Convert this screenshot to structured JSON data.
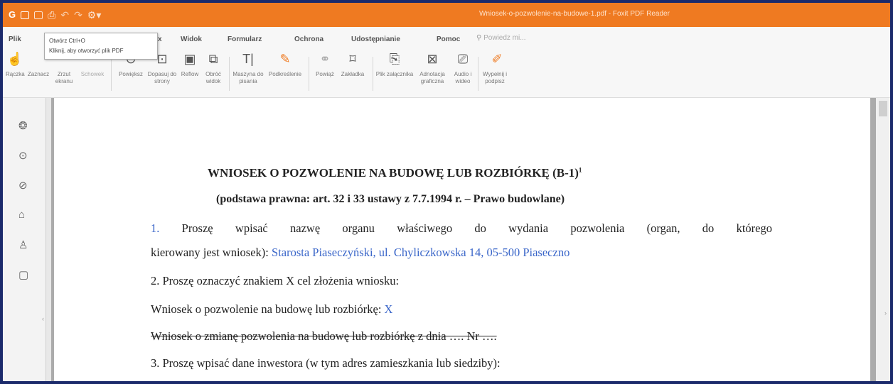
{
  "window": {
    "title": "Wniosek-o-pozwolenie-na-budowe-1.pdf - Foxit PDF Reader"
  },
  "quick_access": {
    "icons": [
      "app-logo-icon",
      "open-icon",
      "save-icon",
      "print-icon",
      "undo-icon",
      "redo-icon",
      "customize-icon"
    ]
  },
  "menu": {
    "items": [
      "Plik",
      "Widok",
      "Formularz",
      "Ochrona",
      "Udostępnianie",
      "Pomoc"
    ],
    "search_placeholder": "Powiedz mi..."
  },
  "tooltip": {
    "line1": "Otwórz   Ctrl+O",
    "line2": "Kliknij, aby otworzyć plik PDF"
  },
  "toolbar": {
    "tools": [
      {
        "label": "Rączka",
        "icon": "hand-icon"
      },
      {
        "label": "Zaznacz",
        "icon": "select-icon"
      },
      {
        "label": "Zrzut ekranu",
        "icon": "snapshot-icon"
      },
      {
        "label": "Schowek",
        "icon": "clipboard-icon"
      },
      {
        "label": "Powiększ",
        "icon": "zoom-icon"
      },
      {
        "label": "Dopasuj do strony",
        "icon": "fit-page-icon"
      },
      {
        "label": "Reflow",
        "icon": "reflow-icon"
      },
      {
        "label": "Obróć widok",
        "icon": "rotate-icon"
      },
      {
        "label": "Maszyna do pisania",
        "icon": "typewriter-icon"
      },
      {
        "label": "Podkreślenie",
        "icon": "highlight-icon"
      },
      {
        "label": "Powiąż",
        "icon": "link-icon"
      },
      {
        "label": "Zakładka",
        "icon": "bookmark-icon"
      },
      {
        "label": "Plik załącznika",
        "icon": "attachment-file-icon"
      },
      {
        "label": "Adnotacja graficzna",
        "icon": "image-annotation-icon"
      },
      {
        "label": "Audio i wideo",
        "icon": "audio-video-icon"
      },
      {
        "label": "Wypełnij i podpisz",
        "icon": "fill-sign-icon"
      }
    ]
  },
  "sidebar": {
    "icons": [
      "layers-icon",
      "comments-icon",
      "attachments-icon",
      "security-icon",
      "signature-icon",
      "pages-icon"
    ]
  },
  "document": {
    "heading": "WNIOSEK O POZWOLENIE NA BUDOWĘ LUB ROZBIÓRKĘ (B-1)",
    "heading_sup": "1",
    "subheading": "(podstawa prawna: art. 32 i 33 ustawy z 7.7.1994 r. – Prawo budowlane)",
    "p1_words": [
      "1.",
      "Proszę",
      "wpisać",
      "nazwę",
      "organu",
      "właściwego",
      "do",
      "wydania",
      "pozwolenia",
      "(organ,",
      "do",
      "którego"
    ],
    "p1_line2_text": "kierowany jest wniosek): ",
    "p1_line2_value": "Starosta Piaseczyński, ul. Chyliczkowska 14, 05-500 Piaseczno",
    "p2": "2. Proszę oznaczyć znakiem X cel złożenia wniosku:",
    "p3_text": "Wniosek o pozwolenie na budowę lub rozbiórkę: ",
    "p3_value": "X",
    "p4_strike": "Wniosek o zmianę pozwolenia na budowę lub rozbiórkę z dnia …. Nr ….",
    "p5": "3. Proszę wpisać dane inwestora (w tym adres zamieszkania lub siedziby):"
  }
}
